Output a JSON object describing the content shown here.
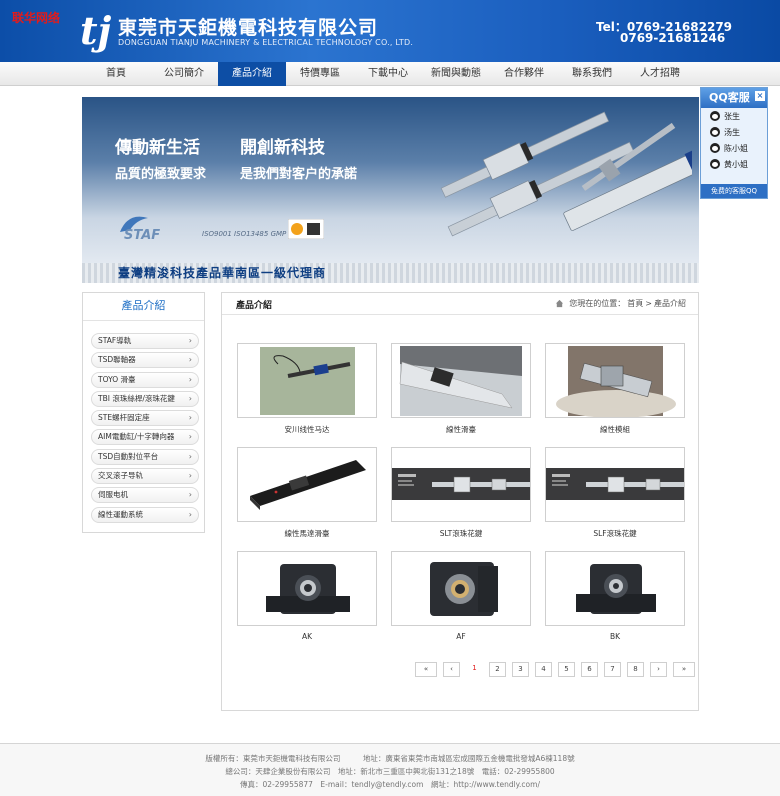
{
  "header": {
    "watermark": "联华网络",
    "company_cn": "東莞市天鉅機電科技有限公司",
    "company_en": "DONGGUAN TIANJU MACHINERY & ELECTRICAL TECHNOLOGY CO., LTD.",
    "tel1": "Tel：0769-21682279",
    "tel2": "0769-21681246",
    "colors": {
      "header_blue": "#1b5fbf",
      "nav_active": "#0d4ea5"
    }
  },
  "nav": {
    "items": [
      "首頁",
      "公司簡介",
      "產品介紹",
      "特價專區",
      "下載中心",
      "新聞與動態",
      "合作夥伴",
      "聯系我們",
      "人才招聘"
    ],
    "active_index": 2
  },
  "banner": {
    "slogan1": "傳動新生活",
    "slogan2": "開創新科技",
    "slogan3": "品質的極致要求",
    "slogan4": "是我們對客户的承諾",
    "iso": "ISO9001 ISO13485 GMP",
    "tagline": "臺灣精浚科技產品華南區一級代理商",
    "logo_text": "STAF"
  },
  "qq": {
    "title": "QQ客服",
    "close": "×",
    "agents": [
      "张生",
      "汤生",
      "陈小姐",
      "黄小姐"
    ],
    "footer": "免费的客服QQ"
  },
  "sidebar": {
    "title": "產品介紹",
    "items": [
      "STAF導軌",
      "TSD聯軸器",
      "TOYO 滑臺",
      "TBI 滾珠絲桿/滾珠花鍵",
      "STE螺杆固定座",
      "AIM電動缸/十字轉向器",
      "TSD自動對位平台",
      "交叉滚子导轨",
      "伺服电机",
      "線性運動系統"
    ]
  },
  "main": {
    "title": "產品介紹",
    "crumb_prefix": "您現在的位置：",
    "crumb_home": "首頁",
    "crumb_sep": ">",
    "crumb_current": "產品介紹",
    "products": [
      {
        "name": "安川线性马达",
        "icon": "linear-motor-photo"
      },
      {
        "name": "線性滑臺",
        "icon": "linear-stage-photo"
      },
      {
        "name": "線性模組",
        "icon": "linear-module-photo"
      },
      {
        "name": "線性馬達滑臺",
        "icon": "linear-motor-stage-photo"
      },
      {
        "name": "SLT滾珠花鍵",
        "icon": "ball-spline-photo"
      },
      {
        "name": "SLF滾珠花鍵",
        "icon": "ball-spline-photo"
      },
      {
        "name": "AK",
        "icon": "bearing-block-photo"
      },
      {
        "name": "AF",
        "icon": "bearing-block-photo"
      },
      {
        "name": "BK",
        "icon": "bearing-block-photo"
      }
    ],
    "pager": {
      "first": "«",
      "prev": "‹",
      "pages": [
        "1",
        "2",
        "3",
        "4",
        "5",
        "6",
        "7",
        "8"
      ],
      "current": "1",
      "next": "›",
      "last": "»"
    }
  },
  "footer": {
    "line1": "版權所有：東莞市天鉅機電科技有限公司　　　地址：廣東省東莞市南城區宏成國際五金機電批發城A6棟118號",
    "line2": "總公司：天肆企業股份有限公司　地址：新北市三重區中興北街131之18號　電話：02-29955800",
    "line3": "傳真：02-29955877　E-mail：tendly@tendly.com　網址：http://www.tendly.com/"
  }
}
